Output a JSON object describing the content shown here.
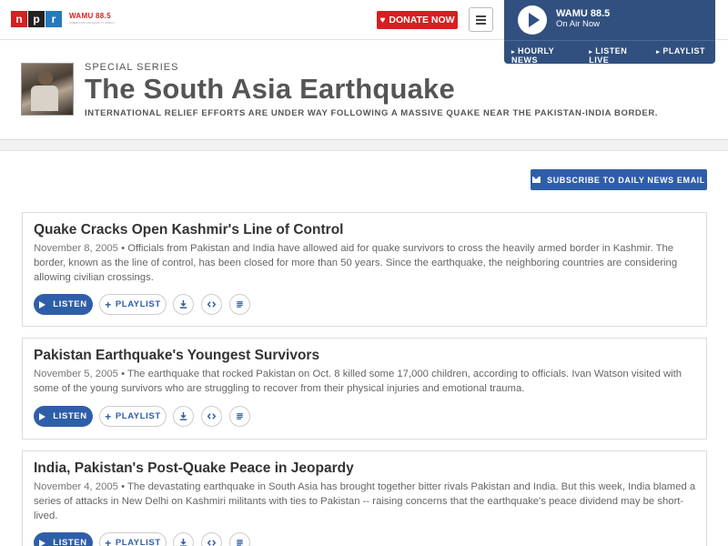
{
  "header": {
    "npr_logo": [
      "n",
      "p",
      "r"
    ],
    "station_logo_text": "WAMU 88.5",
    "station_logo_subtext": "AMERICAN UNIVERSITY RADIO",
    "donate_label": "DONATE NOW",
    "menu_icon": "hamburger-icon",
    "brand_color": "#d62021"
  },
  "on_air": {
    "station": "WAMU 88.5",
    "status": "On Air Now",
    "links": [
      "HOURLY NEWS",
      "LISTEN LIVE",
      "PLAYLIST"
    ],
    "background_color": "#31507f"
  },
  "series": {
    "label": "SPECIAL SERIES",
    "title": "The South Asia Earthquake",
    "description": "INTERNATIONAL RELIEF EFFORTS ARE UNDER WAY FOLLOWING A MASSIVE QUAKE NEAR THE PAKISTAN-INDIA BORDER."
  },
  "subscribe_label": "SUBSCRIBE TO DAILY NEWS EMAIL",
  "stories": [
    {
      "title": "Quake Cracks Open Kashmir's Line of Control",
      "date": "November 8, 2005",
      "teaser": "Officials from Pakistan and India have allowed aid for quake survivors to cross the heavily armed border in Kashmir. The border, known as the line of control, has been closed for more than 50 years. Since the earthquake, the neighboring countries are considering allowing civilian crossings."
    },
    {
      "title": "Pakistan Earthquake's Youngest Survivors",
      "date": "November 5, 2005",
      "teaser": "The earthquake that rocked Pakistan on Oct. 8 killed some 17,000 children, according to officials. Ivan Watson visited with some of the young survivors who are struggling to recover from their physical injuries and emotional trauma."
    },
    {
      "title": "India, Pakistan's Post-Quake Peace in Jeopardy",
      "date": "November 4, 2005",
      "teaser": "The devastating earthquake in South Asia has brought together bitter rivals Pakistan and India. But this week, India blamed a series of attacks in New Delhi on Kashmiri militants with ties to Pakistan -- raising concerns that the earthquake's peace dividend may be short-lived."
    }
  ],
  "story_actions": {
    "listen_label": "LISTEN",
    "playlist_label": "PLAYLIST",
    "icons": [
      "download-icon",
      "embed-icon",
      "transcript-icon"
    ]
  },
  "accent_color": "#2f5ea8"
}
